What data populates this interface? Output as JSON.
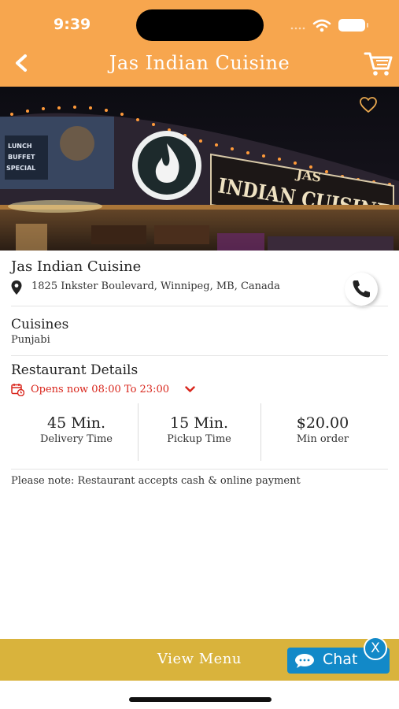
{
  "status_bar": {
    "time": "9:39"
  },
  "header": {
    "title": "Jas Indian Cuisine"
  },
  "hero": {
    "sign_text_small": "JAS",
    "sign_text_main": "INDIAN CUISINE",
    "board_lines": [
      "LUNCH",
      "BUFFET",
      "SPECIAL"
    ]
  },
  "restaurant": {
    "name": "Jas Indian Cuisine",
    "address": "1825 Inkster Boulevard, Winnipeg, MB, Canada"
  },
  "cuisines": {
    "title": "Cuisines",
    "value": "Punjabi"
  },
  "details": {
    "title": "Restaurant Details",
    "hours": "Opens now 08:00 To 23:00",
    "stats": [
      {
        "value": "45 Min.",
        "label": "Delivery Time"
      },
      {
        "value": "15 Min.",
        "label": "Pickup Time"
      },
      {
        "value": "$20.00",
        "label": "Min order"
      }
    ]
  },
  "note": "Please note: Restaurant accepts cash & online payment",
  "bottom": {
    "view_menu": "View Menu"
  },
  "chat": {
    "label": "Chat",
    "close": "X"
  },
  "colors": {
    "header": "#f7a64e",
    "bottom_bar": "#d9b33c",
    "chat": "#1289c8",
    "hours": "#d9261c"
  }
}
